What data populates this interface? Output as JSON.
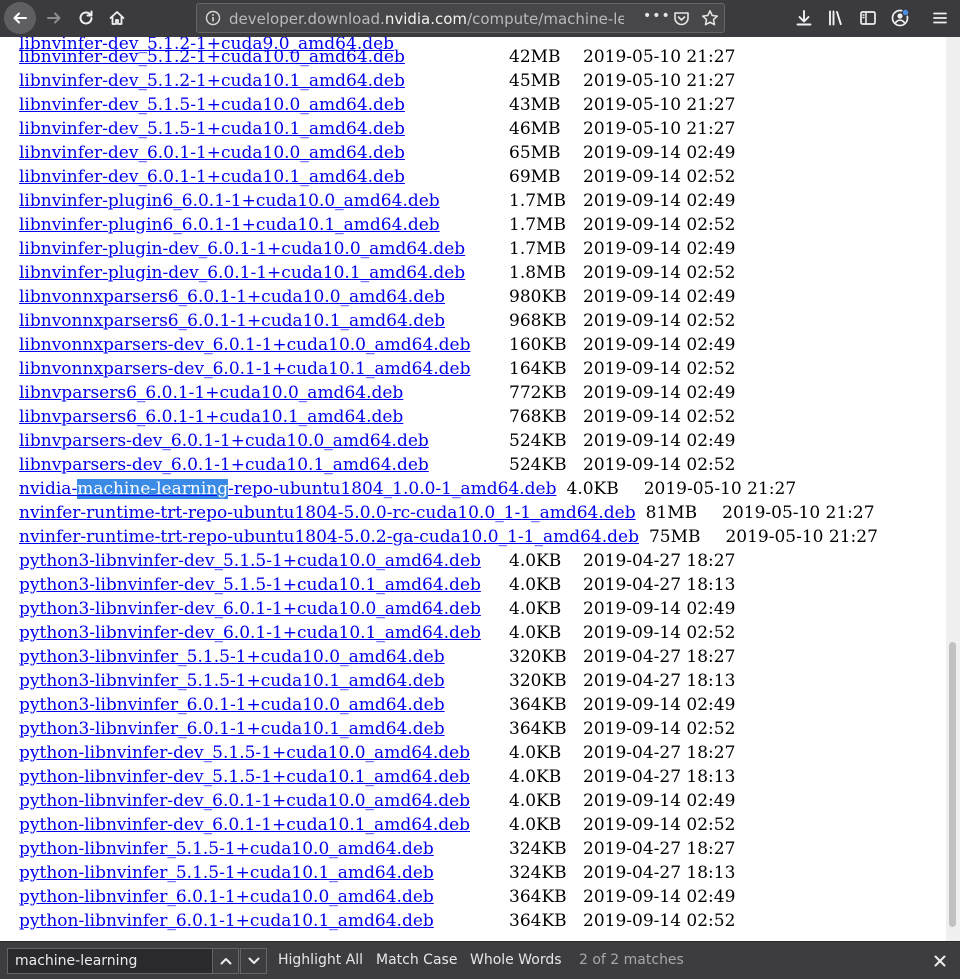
{
  "browser": {
    "url_prefix": "developer.download.",
    "url_host": "nvidia.com",
    "url_path": "/compute/machine-learn",
    "ellipsis": "•••"
  },
  "rows": [
    {
      "name": "libnvinfer-dev_5.1.2-1+cuda10.0_amd64.deb",
      "size": "42MB",
      "date": "2019-05-10 21:27"
    },
    {
      "name": "libnvinfer-dev_5.1.2-1+cuda10.1_amd64.deb",
      "size": "45MB",
      "date": "2019-05-10 21:27"
    },
    {
      "name": "libnvinfer-dev_5.1.5-1+cuda10.0_amd64.deb",
      "size": "43MB",
      "date": "2019-05-10 21:27"
    },
    {
      "name": "libnvinfer-dev_5.1.5-1+cuda10.1_amd64.deb",
      "size": "46MB",
      "date": "2019-05-10 21:27"
    },
    {
      "name": "libnvinfer-dev_6.0.1-1+cuda10.0_amd64.deb",
      "size": "65MB",
      "date": "2019-09-14 02:49"
    },
    {
      "name": "libnvinfer-dev_6.0.1-1+cuda10.1_amd64.deb",
      "size": "69MB",
      "date": "2019-09-14 02:52"
    },
    {
      "name": "libnvinfer-plugin6_6.0.1-1+cuda10.0_amd64.deb",
      "size": "1.7MB",
      "date": "2019-09-14 02:49"
    },
    {
      "name": "libnvinfer-plugin6_6.0.1-1+cuda10.1_amd64.deb",
      "size": "1.7MB",
      "date": "2019-09-14 02:52"
    },
    {
      "name": "libnvinfer-plugin-dev_6.0.1-1+cuda10.0_amd64.deb",
      "size": "1.7MB",
      "date": "2019-09-14 02:49"
    },
    {
      "name": "libnvinfer-plugin-dev_6.0.1-1+cuda10.1_amd64.deb",
      "size": "1.8MB",
      "date": "2019-09-14 02:52"
    },
    {
      "name": "libnvonnxparsers6_6.0.1-1+cuda10.0_amd64.deb",
      "size": "980KB",
      "date": "2019-09-14 02:49"
    },
    {
      "name": "libnvonnxparsers6_6.0.1-1+cuda10.1_amd64.deb",
      "size": "968KB",
      "date": "2019-09-14 02:52"
    },
    {
      "name": "libnvonnxparsers-dev_6.0.1-1+cuda10.0_amd64.deb",
      "size": "160KB",
      "date": "2019-09-14 02:49"
    },
    {
      "name": "libnvonnxparsers-dev_6.0.1-1+cuda10.1_amd64.deb",
      "size": "164KB",
      "date": "2019-09-14 02:52"
    },
    {
      "name": "libnvparsers6_6.0.1-1+cuda10.0_amd64.deb",
      "size": "772KB",
      "date": "2019-09-14 02:49"
    },
    {
      "name": "libnvparsers6_6.0.1-1+cuda10.1_amd64.deb",
      "size": "768KB",
      "date": "2019-09-14 02:52"
    },
    {
      "name": "libnvparsers-dev_6.0.1-1+cuda10.0_amd64.deb",
      "size": "524KB",
      "date": "2019-09-14 02:49"
    },
    {
      "name": "libnvparsers-dev_6.0.1-1+cuda10.1_amd64.deb",
      "size": "524KB",
      "date": "2019-09-14 02:52"
    },
    {
      "name": "nvidia-machine-learning-repo-ubuntu1804_1.0.0-1_amd64.deb",
      "name_pre": "nvidia-",
      "name_match": "machine-learning",
      "name_post": "-repo-ubuntu1804_1.0.0-1_amd64.deb",
      "size": "4.0KB",
      "date": "2019-05-10 21:27"
    },
    {
      "name": "nvinfer-runtime-trt-repo-ubuntu1804-5.0.0-rc-cuda10.0_1-1_amd64.deb",
      "size": "81MB",
      "date": "2019-05-10 21:27"
    },
    {
      "name": "nvinfer-runtime-trt-repo-ubuntu1804-5.0.2-ga-cuda10.0_1-1_amd64.deb",
      "size": "75MB",
      "date": "2019-05-10 21:27"
    },
    {
      "name": "python3-libnvinfer-dev_5.1.5-1+cuda10.0_amd64.deb",
      "size": "4.0KB",
      "date": "2019-04-27 18:27"
    },
    {
      "name": "python3-libnvinfer-dev_5.1.5-1+cuda10.1_amd64.deb",
      "size": "4.0KB",
      "date": "2019-04-27 18:13"
    },
    {
      "name": "python3-libnvinfer-dev_6.0.1-1+cuda10.0_amd64.deb",
      "size": "4.0KB",
      "date": "2019-09-14 02:49"
    },
    {
      "name": "python3-libnvinfer-dev_6.0.1-1+cuda10.1_amd64.deb",
      "size": "4.0KB",
      "date": "2019-09-14 02:52"
    },
    {
      "name": "python3-libnvinfer_5.1.5-1+cuda10.0_amd64.deb",
      "size": "320KB",
      "date": "2019-04-27 18:27"
    },
    {
      "name": "python3-libnvinfer_5.1.5-1+cuda10.1_amd64.deb",
      "size": "320KB",
      "date": "2019-04-27 18:13"
    },
    {
      "name": "python3-libnvinfer_6.0.1-1+cuda10.0_amd64.deb",
      "size": "364KB",
      "date": "2019-09-14 02:49"
    },
    {
      "name": "python3-libnvinfer_6.0.1-1+cuda10.1_amd64.deb",
      "size": "364KB",
      "date": "2019-09-14 02:52"
    },
    {
      "name": "python-libnvinfer-dev_5.1.5-1+cuda10.0_amd64.deb",
      "size": "4.0KB",
      "date": "2019-04-27 18:27"
    },
    {
      "name": "python-libnvinfer-dev_5.1.5-1+cuda10.1_amd64.deb",
      "size": "4.0KB",
      "date": "2019-04-27 18:13"
    },
    {
      "name": "python-libnvinfer-dev_6.0.1-1+cuda10.0_amd64.deb",
      "size": "4.0KB",
      "date": "2019-09-14 02:49"
    },
    {
      "name": "python-libnvinfer-dev_6.0.1-1+cuda10.1_amd64.deb",
      "size": "4.0KB",
      "date": "2019-09-14 02:52"
    },
    {
      "name": "python-libnvinfer_5.1.5-1+cuda10.0_amd64.deb",
      "size": "324KB",
      "date": "2019-04-27 18:27"
    },
    {
      "name": "python-libnvinfer_5.1.5-1+cuda10.1_amd64.deb",
      "size": "324KB",
      "date": "2019-04-27 18:13"
    },
    {
      "name": "python-libnvinfer_6.0.1-1+cuda10.0_amd64.deb",
      "size": "364KB",
      "date": "2019-09-14 02:49"
    },
    {
      "name": "python-libnvinfer_6.0.1-1+cuda10.1_amd64.deb",
      "size": "364KB",
      "date": "2019-09-14 02:52"
    }
  ],
  "findbar": {
    "query": "machine-learning",
    "highlight_all": "Highlight All",
    "match_case": "Match Case",
    "whole_words": "Whole Words",
    "status": "2 of 2 matches"
  }
}
